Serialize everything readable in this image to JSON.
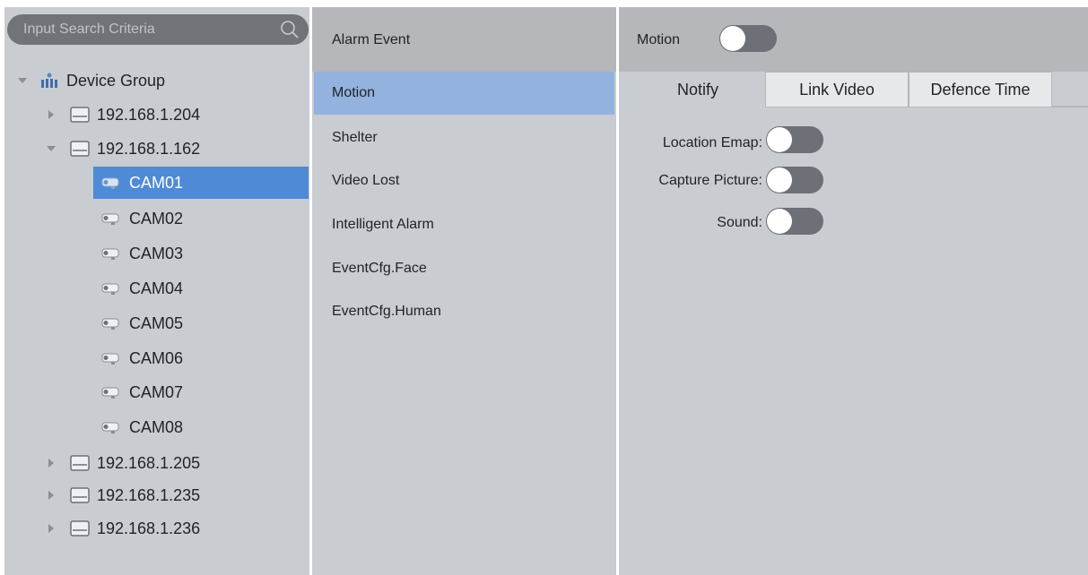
{
  "search": {
    "placeholder": "Input Search Criteria"
  },
  "tree": {
    "root": "Device Group",
    "devices": [
      {
        "label": "192.168.1.204",
        "expanded": false
      },
      {
        "label": "192.168.1.162",
        "expanded": true
      },
      {
        "label": "192.168.1.205",
        "expanded": false
      },
      {
        "label": "192.168.1.235",
        "expanded": false
      },
      {
        "label": "192.168.1.236",
        "expanded": false
      }
    ],
    "cameras": [
      "CAM01",
      "CAM02",
      "CAM03",
      "CAM04",
      "CAM05",
      "CAM06",
      "CAM07",
      "CAM08"
    ],
    "selected_camera": "CAM01"
  },
  "alarm_panel": {
    "header": "Alarm Event",
    "items": [
      "Motion",
      "Shelter",
      "Video Lost",
      "Intelligent Alarm",
      "EventCfg.Face",
      "EventCfg.Human"
    ],
    "selected": "Motion"
  },
  "settings": {
    "title": "Motion",
    "title_toggle_on": false,
    "tabs": [
      "Notify",
      "Link Video",
      "Defence Time"
    ],
    "active_tab": "Notify",
    "options": [
      {
        "label": "Location Emap:",
        "on": false
      },
      {
        "label": "Capture Picture:",
        "on": false
      },
      {
        "label": "Sound:",
        "on": false
      }
    ]
  },
  "colors": {
    "panel_bg": "#c9ccd1",
    "header_bg": "#b5b7bb",
    "selected_tree": "#4f8ad6",
    "selected_list": "#93b3de",
    "toggle_off": "#6d7076",
    "search_bg": "#707378"
  }
}
